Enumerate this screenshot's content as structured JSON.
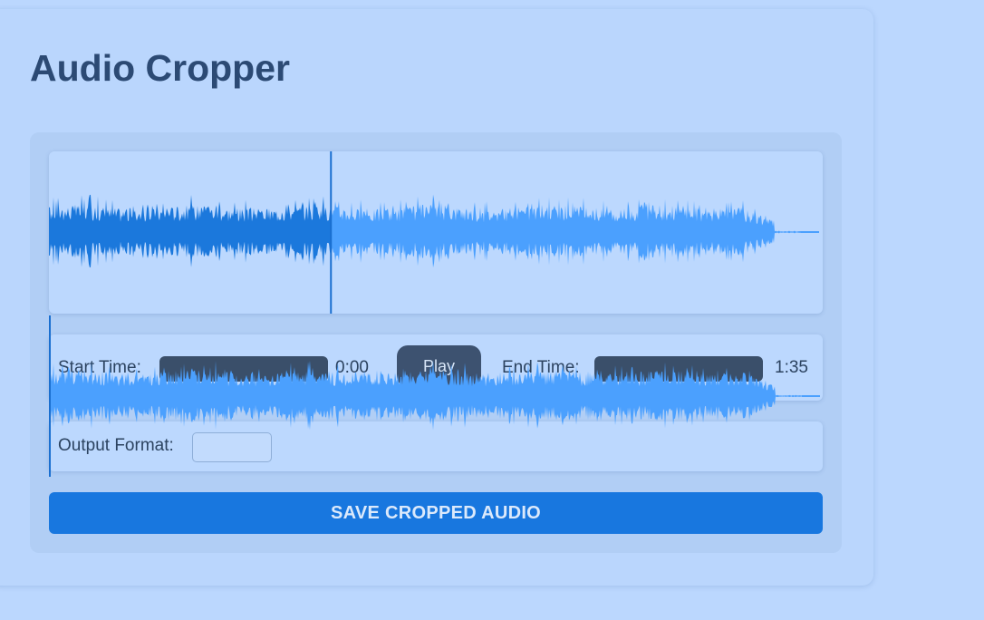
{
  "app": {
    "title": "Audio Cropper"
  },
  "waveform": {
    "progress": 0.375,
    "played_color": "#1b78dc",
    "unplayed_color": "#4ba0fe",
    "cursor_color": "#1a6fd0"
  },
  "controls": {
    "start_time_label": "Start Time:",
    "start_time_value": "0:00",
    "play_label": "Play",
    "end_time_label": "End Time:",
    "end_time_value": "1:35"
  },
  "format": {
    "label": "Output Format:",
    "selected": ""
  },
  "actions": {
    "save_label": "SAVE CROPPED AUDIO"
  },
  "colors": {
    "background": "#bbd7fe",
    "accent": "#1877df",
    "title": "#2c4a74"
  }
}
